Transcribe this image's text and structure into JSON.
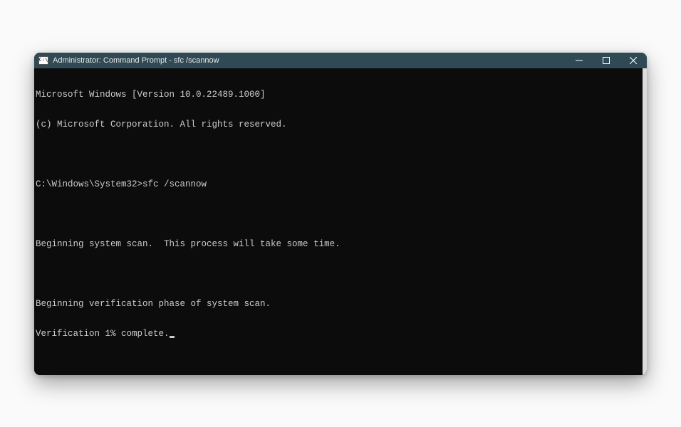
{
  "titlebar": {
    "icon_glyph": "C:\\",
    "title": "Administrator: Command Prompt - sfc  /scannow",
    "minimize_label": "Minimize",
    "maximize_label": "Maximize",
    "close_label": "Close"
  },
  "terminal": {
    "line1": "Microsoft Windows [Version 10.0.22489.1000]",
    "line2": "(c) Microsoft Corporation. All rights reserved.",
    "blank1": "",
    "prompt_path": "C:\\Windows\\System32>",
    "prompt_command": "sfc /scannow",
    "blank2": "",
    "line3": "Beginning system scan.  This process will take some time.",
    "blank3": "",
    "line4": "Beginning verification phase of system scan.",
    "line5": "Verification 1% complete."
  }
}
